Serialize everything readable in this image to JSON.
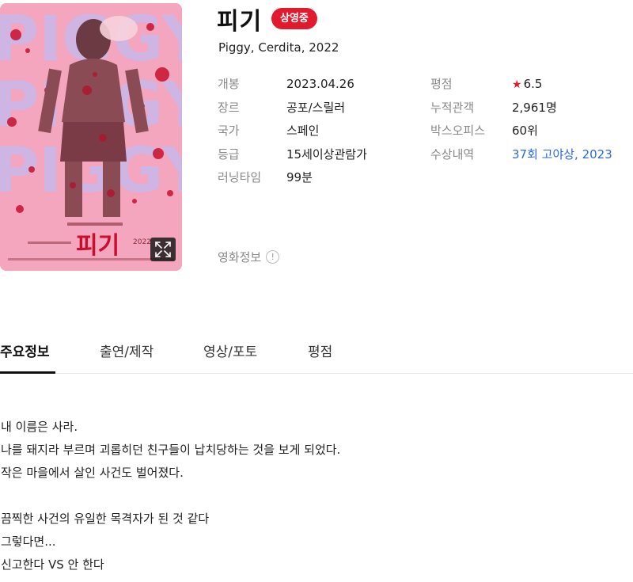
{
  "movie": {
    "title": "피기",
    "status_badge": "상영중",
    "subtitle": "Piggy, Cerdita, 2022"
  },
  "poster": {
    "big_text": "PIGGY",
    "title_text": "피기",
    "colors": {
      "background": "#f3a6bd",
      "text": "#cdb6e6",
      "blood": "#c8102e"
    }
  },
  "info_left": [
    {
      "label": "개봉",
      "value": "2023.04.26"
    },
    {
      "label": "장르",
      "value": "공포/스릴러"
    },
    {
      "label": "국가",
      "value": "스페인"
    },
    {
      "label": "등급",
      "value": "15세이상관람가"
    },
    {
      "label": "러닝타임",
      "value": "99분"
    }
  ],
  "info_right": [
    {
      "label": "평점",
      "value": "6.5",
      "icon": "star-icon"
    },
    {
      "label": "누적관객",
      "value": "2,961명"
    },
    {
      "label": "박스오피스",
      "value": "60위"
    },
    {
      "label": "수상내역",
      "value": "37회 고야상, 2023"
    }
  ],
  "movie_info_link": "영화정보",
  "movie_info_icon": "!",
  "tabs": [
    {
      "label": "주요정보",
      "active": true
    },
    {
      "label": "출연/제작",
      "active": false
    },
    {
      "label": "영상/포토",
      "active": false
    },
    {
      "label": "평점",
      "active": false
    }
  ],
  "synopsis": [
    "내 이름은 사라.",
    "나를 돼지라 부르며 괴롭히던 친구들이 납치당하는 것을 보게 되었다.",
    "작은 마을에서 살인 사건도 벌어졌다.",
    "",
    "끔찍한 사건의 유일한 목격자가 된 것 같다",
    "그렇다면...",
    "신고한다 VS 안 한다"
  ],
  "colors": {
    "accent": "#e11a2e",
    "link": "#2a6ad8",
    "label": "#888888"
  }
}
